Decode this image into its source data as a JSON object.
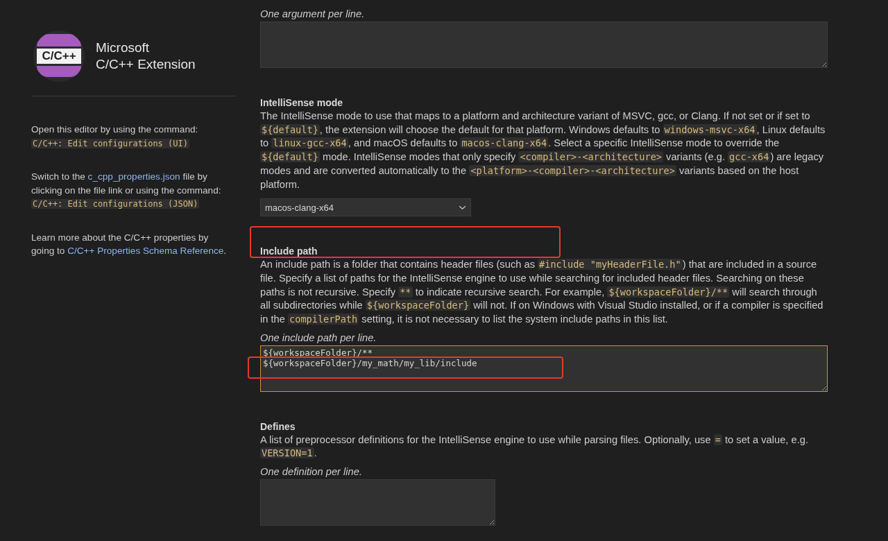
{
  "sidebar": {
    "logo_text": "C/C++",
    "title_lines": [
      "Microsoft",
      "C/C++ Extension"
    ],
    "notes": [
      [
        {
          "kind": "text",
          "text": "Open this editor by using the command: "
        },
        {
          "kind": "code",
          "text": "C/C++: Edit configurations (UI)"
        }
      ],
      [
        {
          "kind": "text",
          "text": "Switch to the "
        },
        {
          "kind": "link",
          "text": "c_cpp_properties.json"
        },
        {
          "kind": "text",
          "text": " file by clicking on the file link or using the command: "
        },
        {
          "kind": "code",
          "text": "C/C++: Edit configurations (JSON)"
        }
      ],
      [
        {
          "kind": "text",
          "text": "Learn more about the C/C++ properties by going to "
        },
        {
          "kind": "link",
          "text": "C/C++ Properties Schema Reference"
        },
        {
          "kind": "text",
          "text": "."
        }
      ]
    ]
  },
  "sections": [
    {
      "kind": "textarea",
      "hint": "One argument per line.",
      "focused": false,
      "wide": true,
      "highlight": false
    },
    {
      "kind": "select",
      "title": "IntelliSense mode",
      "description": [
        {
          "kind": "text",
          "text": "The IntelliSense mode to use that maps to a platform and architecture variant of MSVC, gcc, or Clang. If not set or if set to "
        },
        {
          "kind": "code",
          "text": "${default}"
        },
        {
          "kind": "text",
          "text": ", the extension will choose the default for that platform. Windows defaults to "
        },
        {
          "kind": "code",
          "text": "windows-msvc-x64"
        },
        {
          "kind": "text",
          "text": ", Linux defaults to "
        },
        {
          "kind": "code",
          "text": "linux-gcc-x64"
        },
        {
          "kind": "text",
          "text": ", and macOS defaults to "
        },
        {
          "kind": "code",
          "text": "macos-clang-x64"
        },
        {
          "kind": "text",
          "text": ". Select a specific IntelliSense mode to override the "
        },
        {
          "kind": "code",
          "text": "${default}"
        },
        {
          "kind": "text",
          "text": " mode. IntelliSense modes that only specify "
        },
        {
          "kind": "code",
          "text": "<compiler>-<architecture>"
        },
        {
          "kind": "text",
          "text": " variants (e.g. "
        },
        {
          "kind": "code",
          "text": "gcc-x64"
        },
        {
          "kind": "text",
          "text": ") are legacy modes and are converted automatically to the "
        },
        {
          "kind": "code",
          "text": "<platform>-<compiler>-<architecture>"
        },
        {
          "kind": "text",
          "text": " variants based on the host platform."
        }
      ],
      "value": "macos-clang-x64",
      "highlight": false
    },
    {
      "kind": "textarea",
      "title": "Include path",
      "description": [
        {
          "kind": "text",
          "text": "An include path is a folder that contains header files (such as "
        },
        {
          "kind": "code",
          "text": "#include \"myHeaderFile.h\""
        },
        {
          "kind": "text",
          "text": ") that are included in a source file. Specify a list of paths for the IntelliSense engine to use while searching for included header files. Searching on these paths is not recursive. Specify "
        },
        {
          "kind": "code",
          "text": "**"
        },
        {
          "kind": "text",
          "text": " to indicate recursive search. For example, "
        },
        {
          "kind": "code",
          "text": "${workspaceFolder}/**"
        },
        {
          "kind": "text",
          "text": " will search through all subdirectories while "
        },
        {
          "kind": "code",
          "text": "${workspaceFolder}"
        },
        {
          "kind": "text",
          "text": " will not. If on Windows with Visual Studio installed, or if a compiler is specified in the "
        },
        {
          "kind": "code",
          "text": "compilerPath"
        },
        {
          "kind": "text",
          "text": " setting, it is not necessary to list the system include paths in this list."
        }
      ],
      "hint": "One include path per line.",
      "value": "${workspaceFolder}/**\n${workspaceFolder}/my_math/my_lib/include",
      "focused": true,
      "wide": true,
      "highlight": true
    },
    {
      "kind": "textarea",
      "title": "Defines",
      "description": [
        {
          "kind": "text",
          "text": "A list of preprocessor definitions for the IntelliSense engine to use while parsing files. Optionally, use "
        },
        {
          "kind": "code",
          "text": "="
        },
        {
          "kind": "text",
          "text": " to set a value, e.g. "
        },
        {
          "kind": "code",
          "text": "VERSION=1"
        },
        {
          "kind": "text",
          "text": "."
        }
      ],
      "hint": "One definition per line.",
      "focused": false,
      "wide": false,
      "highlight": false
    }
  ]
}
